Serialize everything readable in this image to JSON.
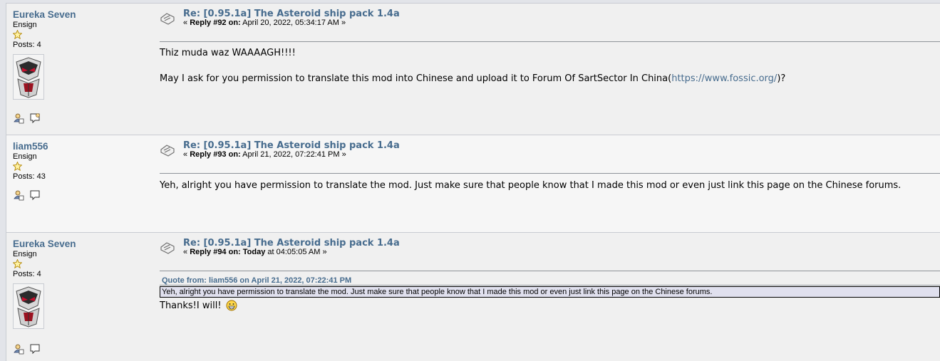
{
  "posts": [
    {
      "poster": {
        "name": "Eureka Seven",
        "rank": "Ensign",
        "posts": "Posts: 4",
        "has_avatar": true
      },
      "subject": "Re: [0.95.1a] The Asteroid ship pack 1.4a",
      "reply_prefix": "« ",
      "reply_label": "Reply #92 on:",
      "reply_date": " April 20, 2022, 05:34:17 AM »",
      "body_line1": "Thiz muda waz WAAAAGH!!!!",
      "body_line2_text": "May I ask for you permission to translate this mod into Chinese and upload it to Forum Of SartSector In China(",
      "body_line2_link": "https://www.fossic.org/",
      "body_line2_tail": ")?"
    },
    {
      "poster": {
        "name": "liam556",
        "rank": "Ensign",
        "posts": "Posts: 43",
        "has_avatar": false
      },
      "subject": "Re: [0.95.1a] The Asteroid ship pack 1.4a",
      "reply_prefix": "« ",
      "reply_label": "Reply #93 on:",
      "reply_date": " April 21, 2022, 07:22:41 PM »",
      "body": "Yeh, alright you have permission to translate the mod. Just make sure that people know that I made this mod or even just link this page on the Chinese forums."
    },
    {
      "poster": {
        "name": "Eureka Seven",
        "rank": "Ensign",
        "posts": "Posts: 4",
        "has_avatar": true
      },
      "subject": "Re: [0.95.1a] The Asteroid ship pack 1.4a",
      "reply_prefix": "« ",
      "reply_label": "Reply #94 on:",
      "reply_today": " Today",
      "reply_date": " at 04:05:05 AM »",
      "quote_header": "Quote from: liam556 on April 21, 2022, 07:22:41 PM",
      "quote_text": "Yeh, alright you have permission to translate the mod. Just make sure that people know that I made this mod or even just link this page on the Chinese forums.",
      "body": "Thanks!I will!"
    }
  ],
  "icons": {
    "post_icon": "message-icon",
    "star": "star-icon",
    "profile": "profile-icon",
    "pm": "personal-message-icon",
    "smiley": "grin-smiley-icon"
  },
  "colors": {
    "link": "#476c8e",
    "quote_bg": "#e0e0ee"
  }
}
